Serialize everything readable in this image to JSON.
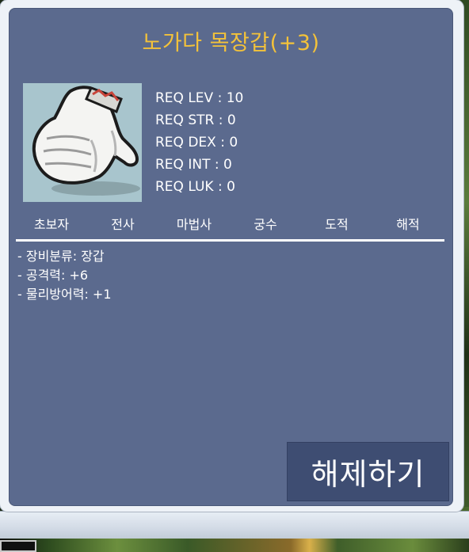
{
  "item": {
    "name": "노가다 목장갑(+3)",
    "name_color": "#f3c23a",
    "icon": "white-work-glove-icon"
  },
  "requirements": [
    "REQ LEV : 10",
    "REQ STR : 0",
    "REQ DEX : 0",
    "REQ INT : 0",
    "REQ LUK : 0"
  ],
  "classes": [
    "초보자",
    "전사",
    "마법사",
    "궁수",
    "도적",
    "해적"
  ],
  "stats": [
    "- 장비분류: 장갑",
    "- 공격력: +6",
    "- 물리방어력: +1"
  ],
  "actions": {
    "unequip_label": "해제하기"
  },
  "colors": {
    "panel": "#5b6a8e",
    "button": "#3e4d72",
    "icon_bg": "#a8c5cd"
  }
}
